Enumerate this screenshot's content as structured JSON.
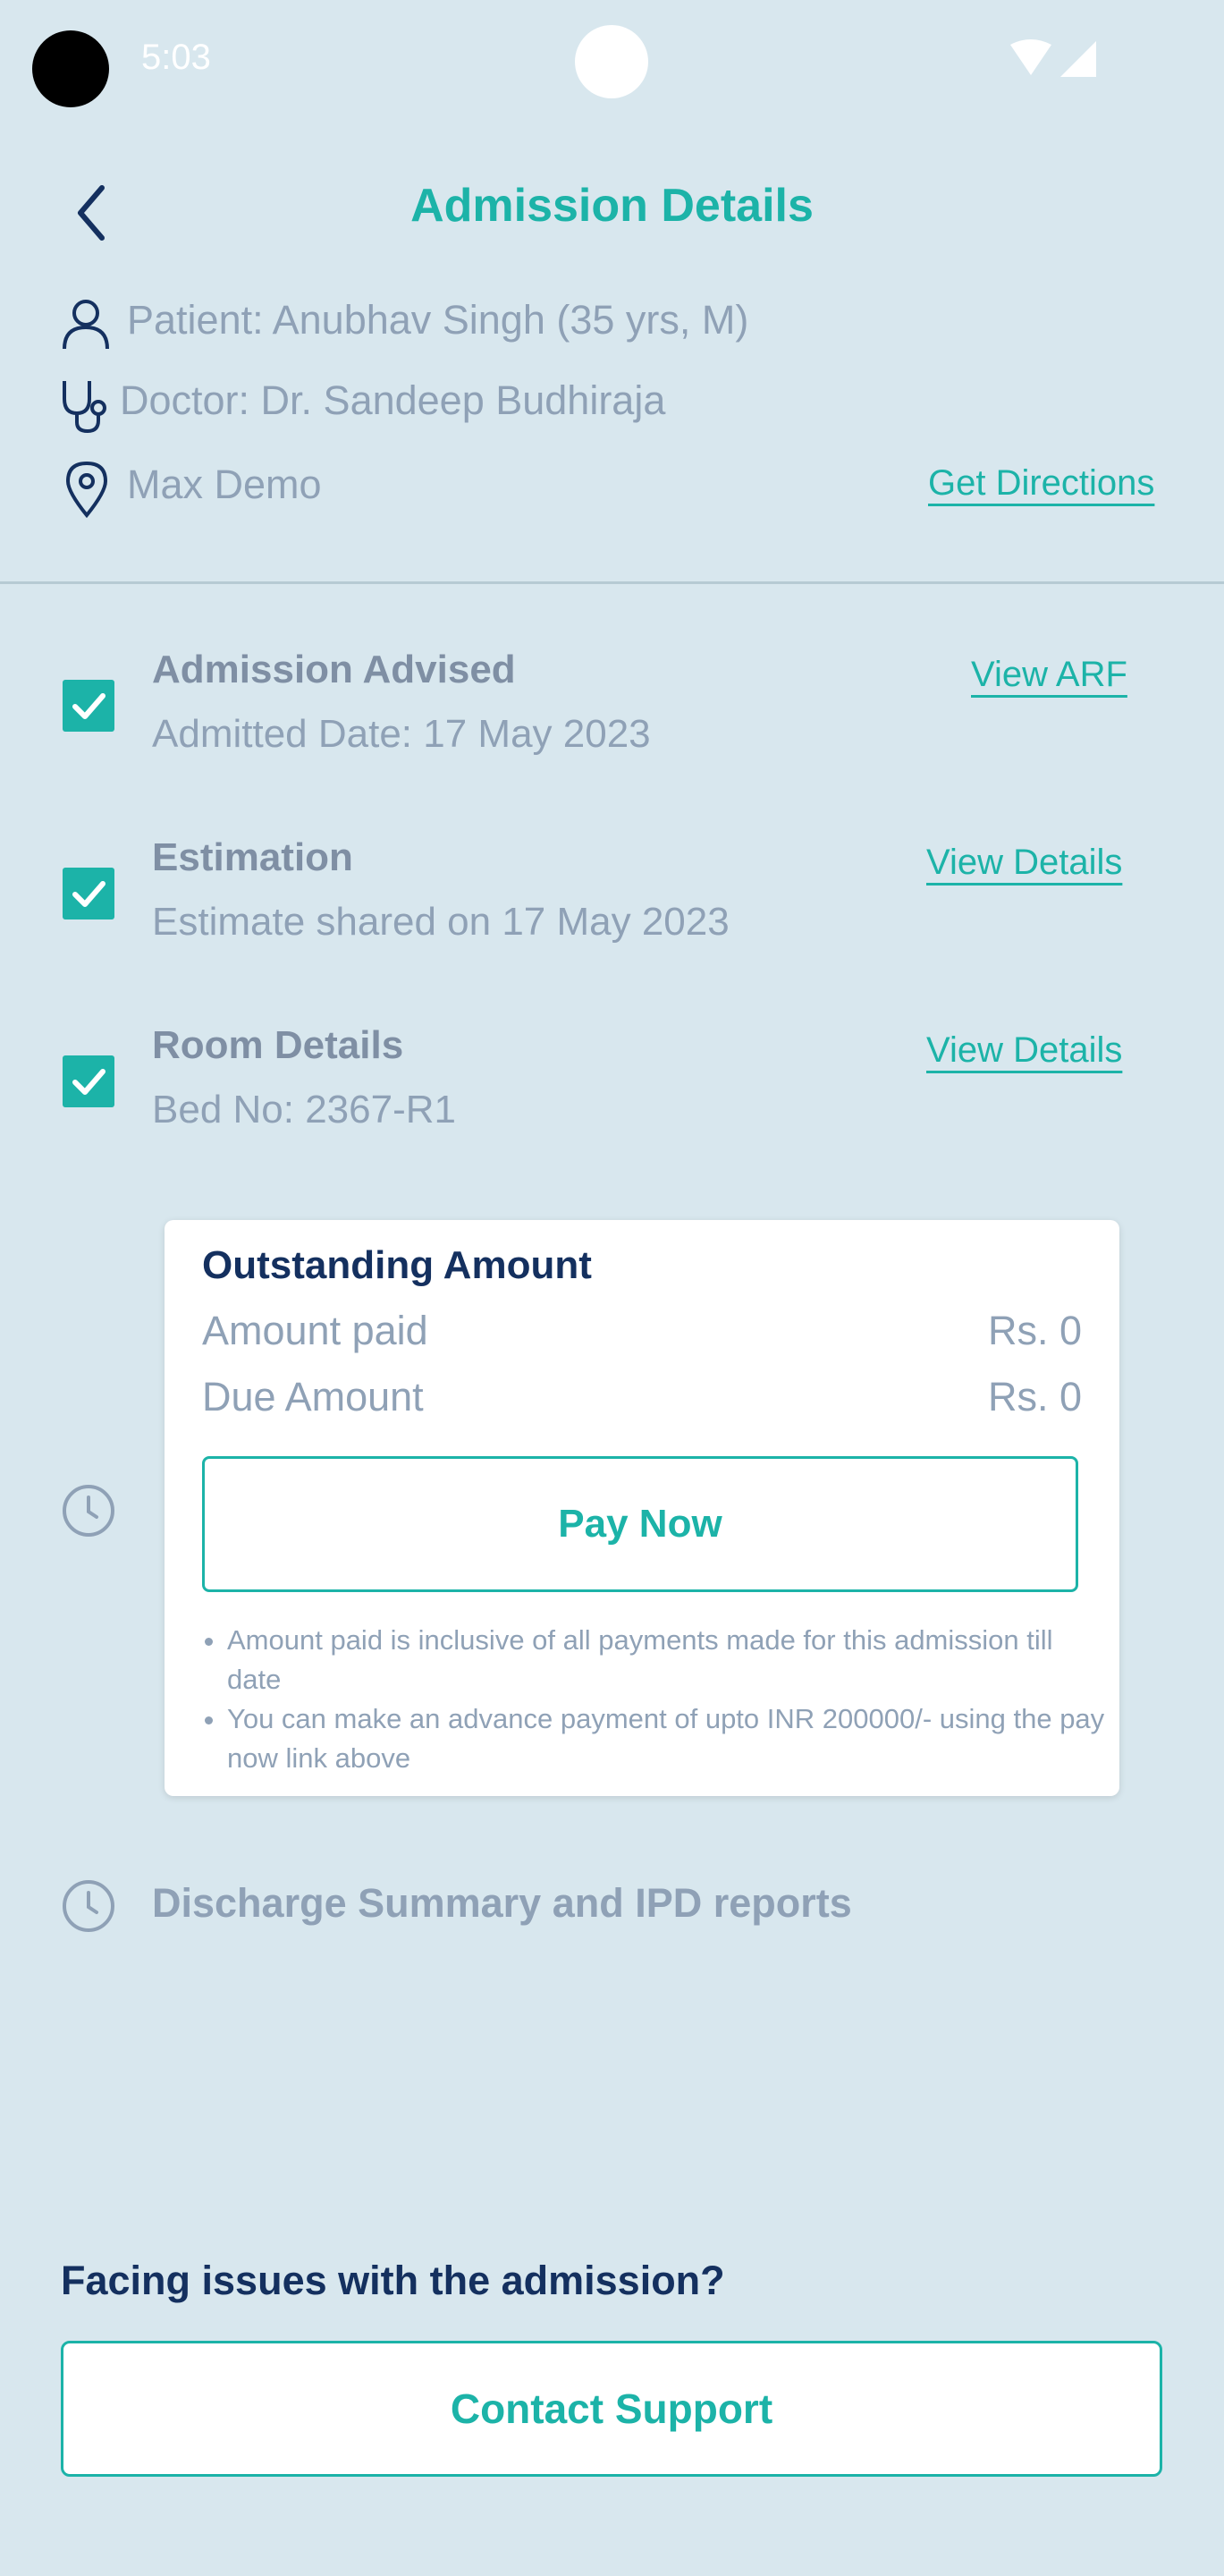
{
  "status_bar": {
    "time": "5:03"
  },
  "header": {
    "title": "Admission Details"
  },
  "info": {
    "patient": "Patient: Anubhav Singh (35 yrs, M)",
    "doctor": "Doctor: Dr. Sandeep Budhiraja",
    "location": "Max Demo",
    "directions_label": "Get Directions"
  },
  "steps": [
    {
      "title": "Admission Advised",
      "detail": "Admitted Date: 17 May 2023",
      "action": "View ARF"
    },
    {
      "title": "Estimation",
      "detail": "Estimate shared on 17 May 2023",
      "action": "View Details"
    },
    {
      "title": "Room Details",
      "detail": "Bed No: 2367-R1",
      "action": "View Details"
    }
  ],
  "outstanding": {
    "title": "Outstanding Amount",
    "rows": [
      {
        "label": "Amount paid",
        "value": "Rs. 0"
      },
      {
        "label": "Due Amount",
        "value": "Rs. 0"
      }
    ],
    "pay_label": "Pay Now",
    "notes": [
      "Amount paid is inclusive of all payments made for this admission till date",
      "You can make an advance payment of upto INR 200000/- using the pay now link above"
    ]
  },
  "discharge": {
    "title": "Discharge Summary and IPD reports"
  },
  "support": {
    "question": "Facing issues with the admission?",
    "button_label": "Contact Support"
  },
  "colors": {
    "accent": "#1cb3a8",
    "navy": "#14305f",
    "background": "#d8e7ee"
  },
  "icons": [
    "back-arrow-icon",
    "person-icon",
    "stethoscope-icon",
    "location-pin-icon",
    "checkbox-checked-icon",
    "clock-icon",
    "wifi-icon",
    "signal-icon"
  ]
}
